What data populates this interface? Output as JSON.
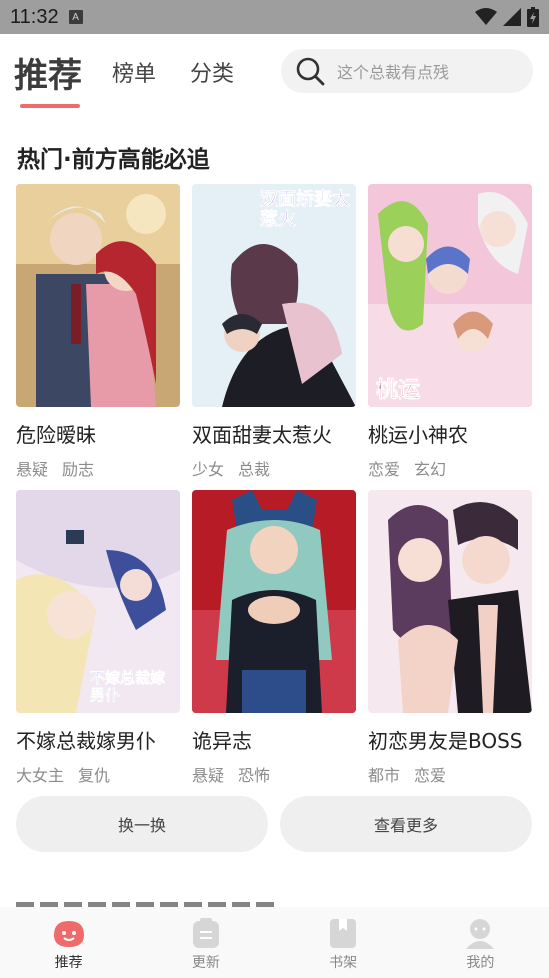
{
  "status": {
    "time": "11:32",
    "notif_letter": "A"
  },
  "nav": {
    "tabs": [
      "推荐",
      "榜单",
      "分类"
    ],
    "search_placeholder": "这个总裁有点残"
  },
  "section": {
    "title": "热门·前方高能必追"
  },
  "comics": [
    {
      "title": "危险暧昧",
      "tags": [
        "悬疑",
        "励志"
      ]
    },
    {
      "title": "双面甜妻太惹火",
      "tags": [
        "少女",
        "总裁"
      ],
      "cover_text": "双面娇妻太惹火"
    },
    {
      "title": "桃运小神农",
      "tags": [
        "恋爱",
        "玄幻"
      ],
      "cover_text": "桃运"
    },
    {
      "title": "不嫁总裁嫁男仆",
      "tags": [
        "大女主",
        "复仇"
      ],
      "cover_text": "不嫁总裁嫁男仆"
    },
    {
      "title": "诡异志",
      "tags": [
        "悬疑",
        "恐怖"
      ]
    },
    {
      "title": "初恋男友是BOSS",
      "tags": [
        "都市",
        "恋爱"
      ]
    }
  ],
  "actions": {
    "refresh": "换一换",
    "more": "查看更多"
  },
  "bottom_nav": [
    "推荐",
    "更新",
    "书架",
    "我的"
  ],
  "colors": {
    "accent": "#ef6b6b",
    "statusbar": "#9e9e9e"
  }
}
